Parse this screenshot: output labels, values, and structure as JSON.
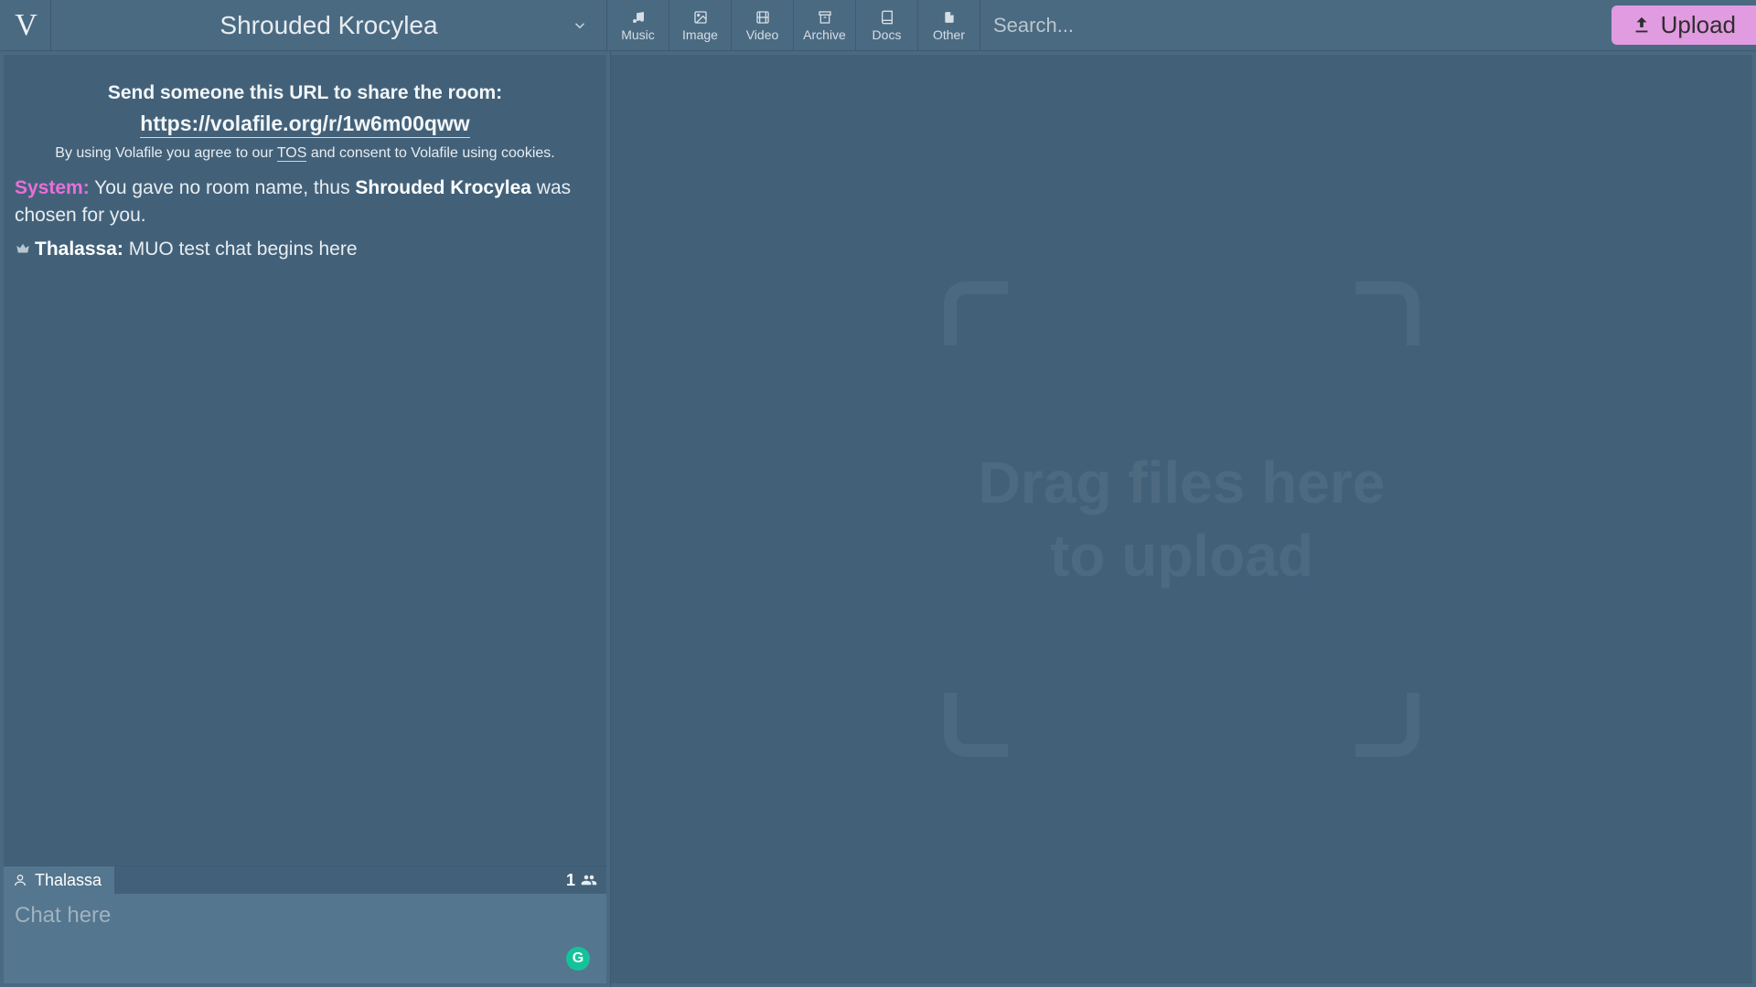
{
  "header": {
    "logo_letter": "V",
    "room_title": "Shrouded Krocylea",
    "filters": [
      {
        "label": "Music"
      },
      {
        "label": "Image"
      },
      {
        "label": "Video"
      },
      {
        "label": "Archive"
      },
      {
        "label": "Docs"
      },
      {
        "label": "Other"
      }
    ],
    "search_placeholder": "Search...",
    "upload_label": "Upload"
  },
  "chat": {
    "share_label": "Send someone this URL to share the room:",
    "share_url": "https://volafile.org/r/1w6m00qww",
    "tos_pre": "By using Volafile you agree to our ",
    "tos_link": "TOS",
    "tos_post": " and consent to Volafile using cookies.",
    "messages": {
      "system_user": "System:",
      "system_pre": "  You gave no room name, thus ",
      "system_strong": "Shrouded Krocylea",
      "system_post": " was chosen for you.",
      "user_name": "Thalassa:",
      "user_text": "  MUO test chat begins here"
    },
    "current_user": "Thalassa",
    "user_count": "1",
    "chat_placeholder": "Chat here",
    "grammarly": "G"
  },
  "dropzone": {
    "text": "Drag files here to upload"
  }
}
